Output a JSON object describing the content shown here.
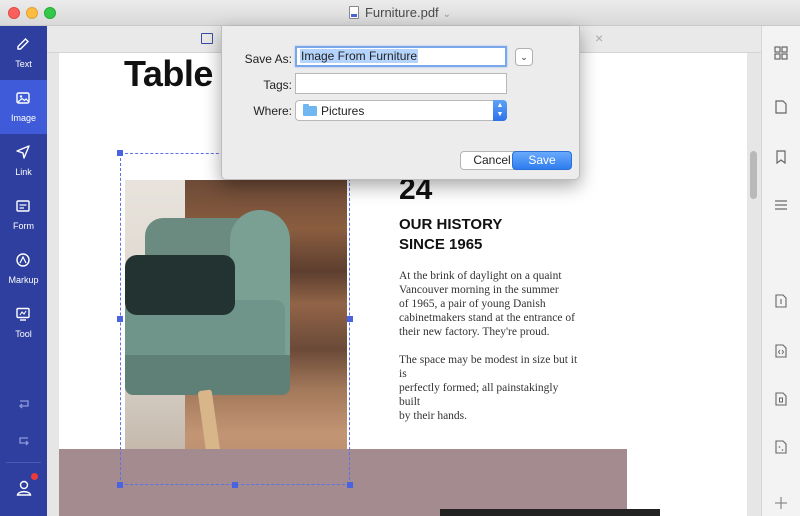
{
  "window": {
    "title": "Furniture.pdf"
  },
  "sidebar": {
    "items": [
      {
        "label": "Text",
        "icon": "pen-icon"
      },
      {
        "label": "Image",
        "icon": "image-icon"
      },
      {
        "label": "Link",
        "icon": "link-icon"
      },
      {
        "label": "Form",
        "icon": "form-icon"
      },
      {
        "label": "Markup",
        "icon": "markup-icon"
      },
      {
        "label": "Tool",
        "icon": "tool-icon"
      }
    ],
    "active": "Image",
    "accent": "#2f3f9f",
    "active_color": "#3f5bd9"
  },
  "document": {
    "heading": "Table c",
    "number": "24",
    "history_line1": "OUR HISTORY",
    "history_line2": "SINCE 1965",
    "para1": [
      "At the brink of daylight on a quaint",
      "Vancouver morning in the summer",
      "of 1965, a pair of young Danish",
      "cabinetmakers stand at the entrance of",
      "their new factory. They're proud."
    ],
    "para2": [
      "The space may be modest in size but it is",
      "perfectly formed; all painstakingly built",
      "by their hands."
    ]
  },
  "dialog": {
    "save_as_label": "Save As:",
    "save_as_value": "Image From Furniture",
    "tags_label": "Tags:",
    "tags_value": "",
    "where_label": "Where:",
    "where_value": "Pictures",
    "cancel_label": "Cancel",
    "save_label": "Save",
    "save_color": "#2f7cf0"
  }
}
